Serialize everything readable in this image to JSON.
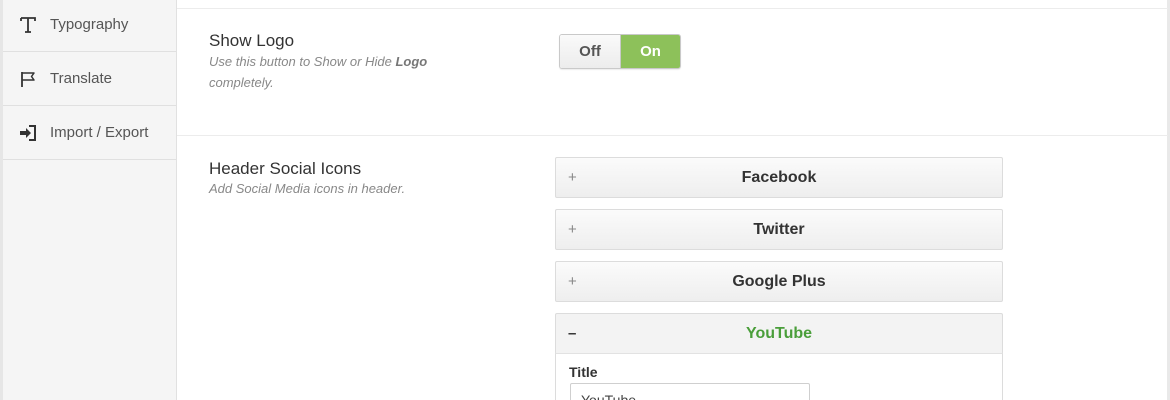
{
  "sidebar": {
    "items": [
      {
        "label": "Typography",
        "icon": "typography-icon"
      },
      {
        "label": "Translate",
        "icon": "flag-icon"
      },
      {
        "label": "Import / Export",
        "icon": "sign-in-icon"
      }
    ]
  },
  "show_logo": {
    "title": "Show Logo",
    "desc_before": "Use this button to Show or Hide ",
    "desc_bold": "Logo",
    "desc_after": " completely.",
    "toggle": {
      "off_label": "Off",
      "on_label": "On",
      "state": "on"
    }
  },
  "social": {
    "title": "Header Social Icons",
    "desc": "Add Social Media icons in header.",
    "items": [
      {
        "label": "Facebook",
        "sign": "+"
      },
      {
        "label": "Twitter",
        "sign": "+"
      },
      {
        "label": "Google Plus",
        "sign": "+"
      },
      {
        "label": "YouTube",
        "sign": "–"
      }
    ],
    "youtube_field": {
      "label": "Title",
      "value": "YouTube"
    }
  },
  "colors": {
    "accent_green": "#8dc15a",
    "open_title_green": "#4a9e3a"
  }
}
